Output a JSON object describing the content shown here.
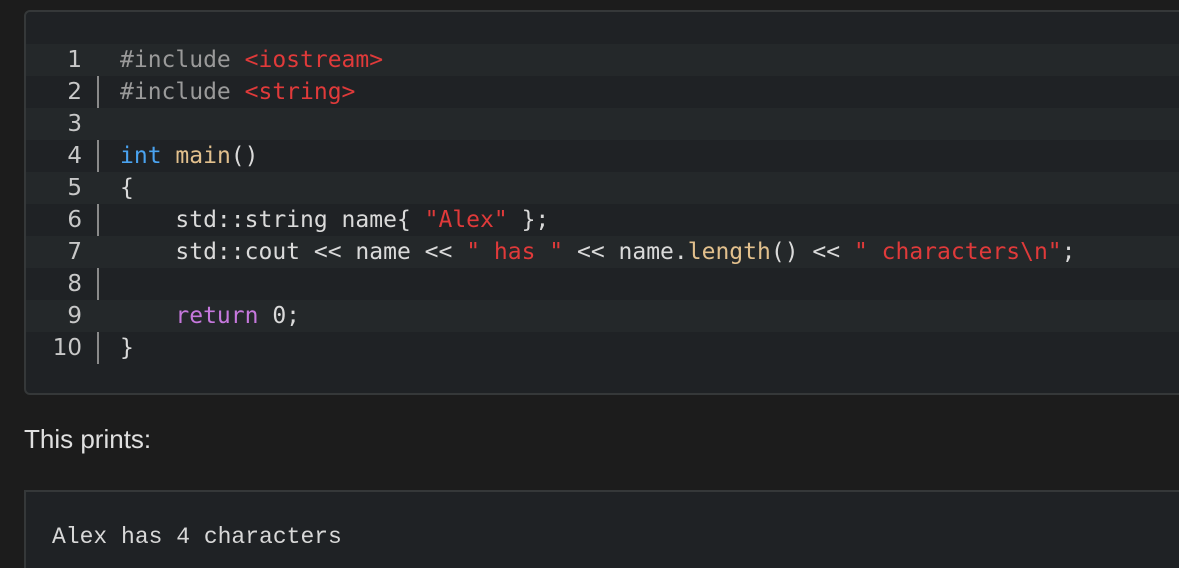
{
  "code_block": {
    "lines": [
      {
        "num": "1",
        "tokens": [
          {
            "t": "#include ",
            "c": "pre"
          },
          {
            "t": "<iostream>",
            "c": "inc"
          }
        ]
      },
      {
        "num": "2",
        "tokens": [
          {
            "t": "#include ",
            "c": "pre"
          },
          {
            "t": "<string>",
            "c": "inc"
          }
        ]
      },
      {
        "num": "3",
        "tokens": []
      },
      {
        "num": "4",
        "tokens": [
          {
            "t": "int",
            "c": "type"
          },
          {
            "t": " ",
            "c": "plain"
          },
          {
            "t": "main",
            "c": "fn"
          },
          {
            "t": "()",
            "c": "plain"
          }
        ]
      },
      {
        "num": "5",
        "tokens": [
          {
            "t": "{",
            "c": "plain"
          }
        ]
      },
      {
        "num": "6",
        "tokens": [
          {
            "t": "    std::string name{ ",
            "c": "plain"
          },
          {
            "t": "\"Alex\"",
            "c": "str"
          },
          {
            "t": " };",
            "c": "plain"
          }
        ]
      },
      {
        "num": "7",
        "tokens": [
          {
            "t": "    std::cout << name << ",
            "c": "plain"
          },
          {
            "t": "\" has \"",
            "c": "str"
          },
          {
            "t": " << name.",
            "c": "plain"
          },
          {
            "t": "length",
            "c": "fn"
          },
          {
            "t": "() << ",
            "c": "plain"
          },
          {
            "t": "\" characters\\n\"",
            "c": "str"
          },
          {
            "t": ";",
            "c": "plain"
          }
        ]
      },
      {
        "num": "8",
        "tokens": []
      },
      {
        "num": "9",
        "tokens": [
          {
            "t": "    ",
            "c": "plain"
          },
          {
            "t": "return",
            "c": "kw"
          },
          {
            "t": " 0;",
            "c": "plain"
          }
        ]
      },
      {
        "num": "10",
        "tokens": [
          {
            "t": "}",
            "c": "plain"
          }
        ]
      }
    ]
  },
  "caption": "This prints:",
  "output": "Alex has 4 characters"
}
